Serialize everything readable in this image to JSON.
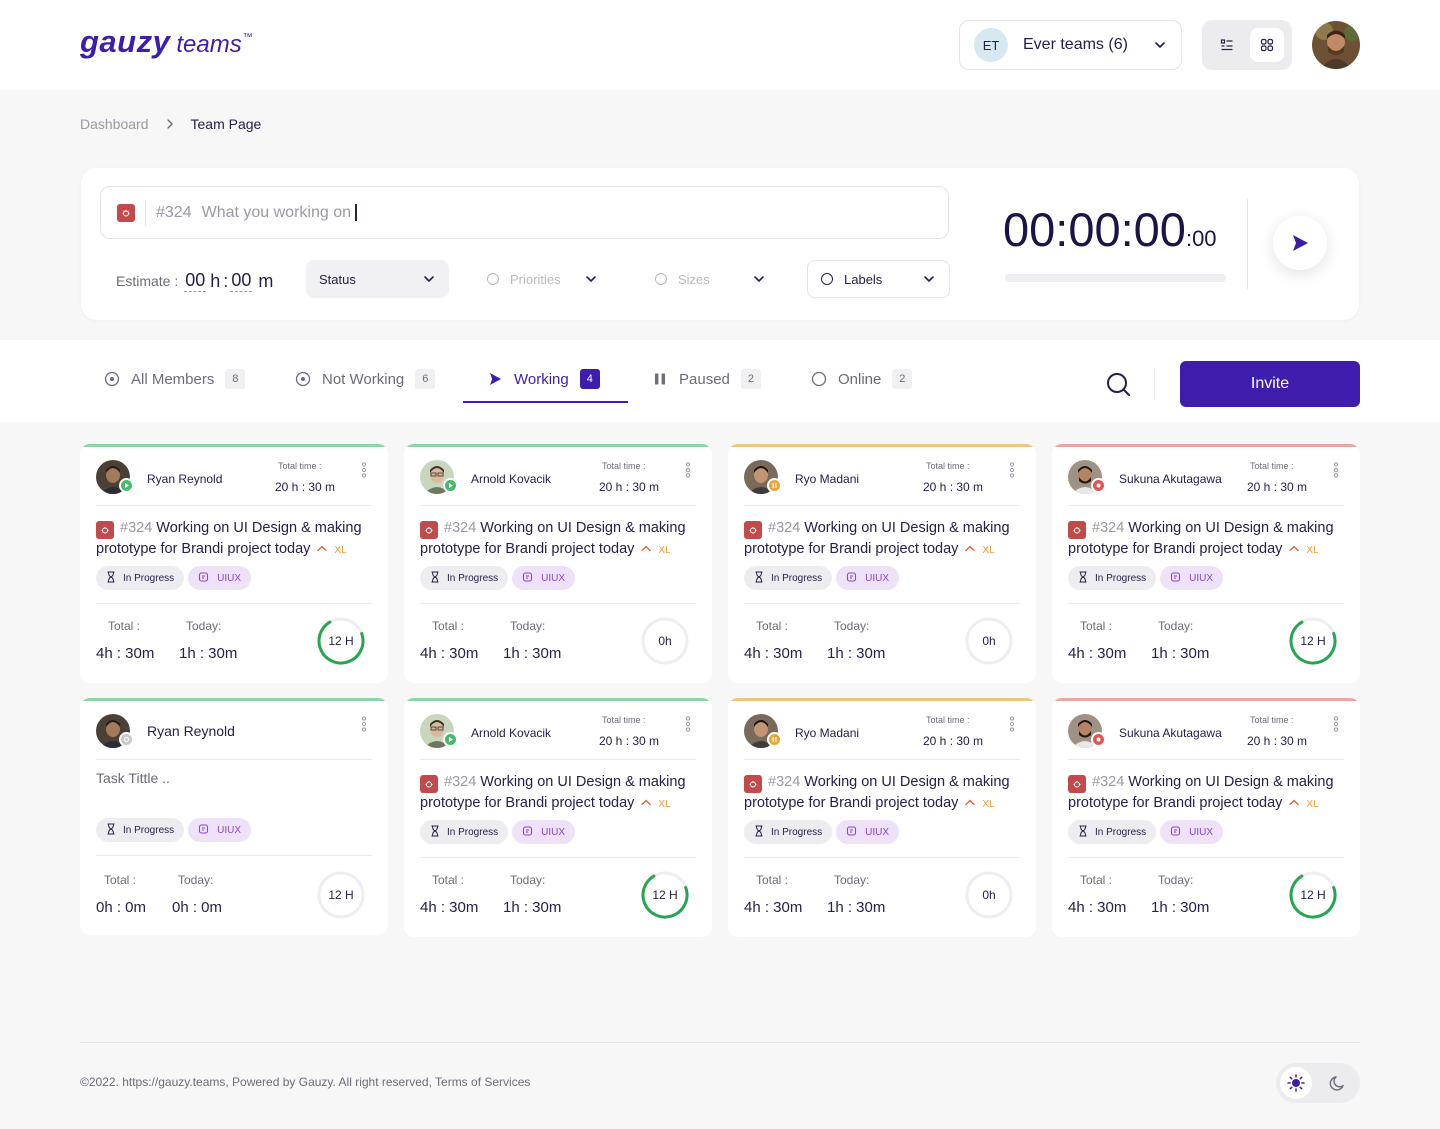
{
  "app": {
    "logo_main": "gauzy",
    "logo_sub": "teams",
    "logo_tm": "™"
  },
  "header": {
    "team_avatar": "ET",
    "team_name": "Ever teams (6)"
  },
  "breadcrumb": [
    "Dashboard",
    "Team Page"
  ],
  "timer_panel": {
    "task_number": "#324",
    "task_placeholder": "What you working on",
    "estimate_label": "Estimate :",
    "estimate_hours": "00",
    "estimate_h_unit": "h",
    "estimate_minutes": "00",
    "estimate_m_unit": "m",
    "status_label": "Status",
    "priorities_label": "Priorities",
    "sizes_label": "Sizes",
    "labels_label": "Labels",
    "clock_main": "00:00:00",
    "clock_ms": ":00",
    "progress": 0
  },
  "tabs": [
    {
      "label": "All Members",
      "count": "8",
      "icon": "circle-dot-icon"
    },
    {
      "label": "Not Working",
      "count": "6",
      "icon": "circle-dot-icon"
    },
    {
      "label": "Working",
      "count": "4",
      "icon": "play-icon",
      "active": true
    },
    {
      "label": "Paused",
      "count": "2",
      "icon": "pause-icon"
    },
    {
      "label": "Online",
      "count": "2",
      "icon": "circle-icon"
    }
  ],
  "invite_label": "Invite",
  "card_labels": {
    "total_time": "Total time :",
    "total": "Total :",
    "today": "Today:",
    "status_tag": "In Progress",
    "label_tag": "UIUX",
    "size": "XL"
  },
  "members": [
    {
      "name": "Ryan Reynold",
      "status": "working",
      "top_color": "#8cd5a7",
      "status_color": "#47b86d",
      "total_time": "20 h : 30 m",
      "task_number": "#324",
      "task_title": "Working on UI Design & making prototype for Brandi project today",
      "total": "4h : 30m",
      "today": "1h : 30m",
      "ring_label": "12 H",
      "ring_progress": 0.72
    },
    {
      "name": "Arnold Kovacik",
      "status": "working",
      "top_color": "#8cd5a7",
      "status_color": "#47b86d",
      "total_time": "20 h : 30 m",
      "task_number": "#324",
      "task_title": "Working on UI Design & making prototype for Brandi project today",
      "total": "4h : 30m",
      "today": "1h : 30m",
      "ring_label": "0h",
      "ring_progress": 0
    },
    {
      "name": "Ryo Madani",
      "status": "paused",
      "top_color": "#ecc57e",
      "status_color": "#eaa43d",
      "total_time": "20 h : 30 m",
      "task_number": "#324",
      "task_title": "Working on UI Design & making prototype for Brandi project today",
      "total": "4h : 30m",
      "today": "1h : 30m",
      "ring_label": "0h",
      "ring_progress": 0
    },
    {
      "name": "Sukuna Akutagawa",
      "status": "offline",
      "top_color": "#eea3a3",
      "status_color": "#e05555",
      "total_time": "20 h : 30 m",
      "task_number": "#324",
      "task_title": "Working on UI Design & making prototype for Brandi project today",
      "total": "4h : 30m",
      "today": "1h : 30m",
      "ring_label": "12 H",
      "ring_progress": 0.72
    },
    {
      "name": "Ryan Reynold",
      "status": "idle",
      "top_color": "#8cd5a7",
      "status_color": "#c9c9cf",
      "total_time": "",
      "task_number": "",
      "task_title": "",
      "task_placeholder": "Task Tittle ..",
      "total": "0h : 0m",
      "today": "0h : 0m",
      "ring_label": "12 H",
      "ring_progress": 0
    },
    {
      "name": "Arnold Kovacik",
      "status": "working",
      "top_color": "#8cd5a7",
      "status_color": "#47b86d",
      "total_time": "20 h : 30 m",
      "task_number": "#324",
      "task_title": "Working on UI Design & making prototype for Brandi project today",
      "total": "4h : 30m",
      "today": "1h : 30m",
      "ring_label": "12 H",
      "ring_progress": 0.72
    },
    {
      "name": "Ryo Madani",
      "status": "paused",
      "top_color": "#ecc57e",
      "status_color": "#eaa43d",
      "total_time": "20 h : 30 m",
      "task_number": "#324",
      "task_title": "Working on UI Design & making prototype for Brandi project today",
      "total": "4h : 30m",
      "today": "1h : 30m",
      "ring_label": "0h",
      "ring_progress": 0
    },
    {
      "name": "Sukuna Akutagawa",
      "status": "offline",
      "top_color": "#eea3a3",
      "status_color": "#e05555",
      "total_time": "20 h : 30 m",
      "task_number": "#324",
      "task_title": "Working on UI Design & making prototype for Brandi project today",
      "total": "4h : 30m",
      "today": "1h : 30m",
      "ring_label": "12 H",
      "ring_progress": 0.72
    }
  ],
  "footer": {
    "copyright": "©2022. https://gauzy.teams, Powered by Gauzy. All right reserved, Terms of Services"
  },
  "theme": {
    "active": "light"
  },
  "colors": {
    "accent": "#3e1dad",
    "working": "#47b86d",
    "paused": "#eaa43d",
    "offline": "#e05555"
  }
}
